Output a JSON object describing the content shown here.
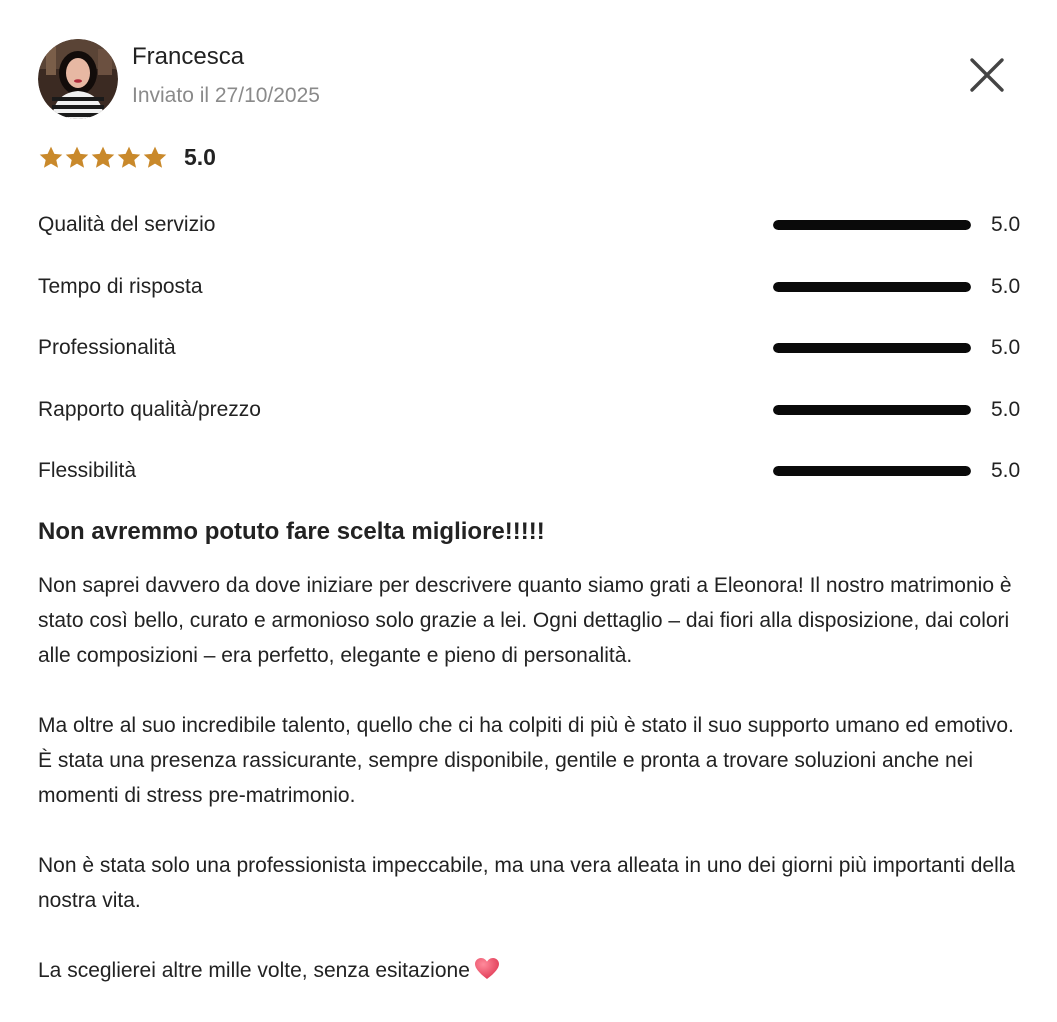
{
  "review": {
    "author": {
      "name": "Francesca",
      "sent_date": "Inviato il 27/10/2025",
      "avatar_icon": "user-avatar-photo"
    },
    "close_icon": "close-icon",
    "overall": {
      "stars": 5,
      "max_stars": 5,
      "score": "5.0",
      "star_color": "#c9892b"
    },
    "ratings": [
      {
        "label": "Qualità del servizio",
        "value": "5.0",
        "fill": 1.0
      },
      {
        "label": "Tempo di risposta",
        "value": "5.0",
        "fill": 1.0
      },
      {
        "label": "Professionalità",
        "value": "5.0",
        "fill": 1.0
      },
      {
        "label": "Rapporto qualità/prezzo",
        "value": "5.0",
        "fill": 1.0
      },
      {
        "label": "Flessibilità",
        "value": "5.0",
        "fill": 1.0
      }
    ],
    "title": "Non avremmo potuto fare scelta migliore!!!!!",
    "paragraphs": [
      "Non saprei davvero da dove iniziare per descrivere quanto siamo grati a Eleonora! Il nostro matrimonio è stato così bello, curato e armonioso solo grazie a lei. Ogni dettaglio – dai fiori alla disposizione, dai colori alle composizioni – era perfetto, elegante e pieno di personalità.",
      "Ma oltre al suo incredibile talento, quello che ci ha colpiti di più è stato il suo supporto umano ed emotivo. È stata una presenza rassicurante, sempre disponibile, gentile e pronta a trovare soluzioni anche nei momenti di stress pre-matrimonio.",
      "Non è stata solo una professionista impeccabile, ma una vera alleata in uno dei giorni più importanti della nostra vita.",
      "La sceglierei altre mille volte, senza esitazione"
    ],
    "closing_icon": "heart-icon",
    "heart_color": "#e8475f"
  }
}
